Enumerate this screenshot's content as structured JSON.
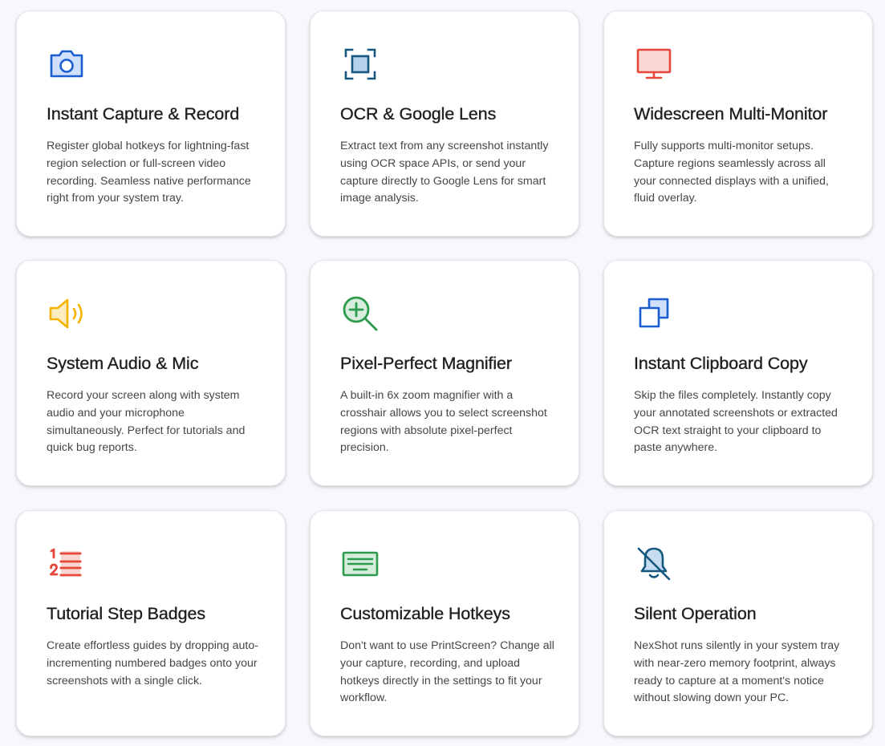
{
  "features": [
    {
      "title": "Instant Capture & Record",
      "description": "Register global hotkeys for lightning-fast region selection or full-screen video recording. Seamless native performance right from your system tray.",
      "icon": "camera-icon",
      "color": "#1a5dd1"
    },
    {
      "title": "OCR & Google Lens",
      "description": "Extract text from any screenshot instantly using OCR space APIs, or send your capture directly to Google Lens for smart image analysis.",
      "icon": "scan-frame-icon",
      "color": "#14577f"
    },
    {
      "title": "Widescreen Multi-Monitor",
      "description": "Fully supports multi-monitor setups. Capture regions seamlessly across all your connected displays with a unified, fluid overlay.",
      "icon": "monitor-icon",
      "color": "#e5483b"
    },
    {
      "title": "System Audio & Mic",
      "description": "Record your screen along with system audio and your microphone simultaneously. Perfect for tutorials and quick bug reports.",
      "icon": "speaker-icon",
      "color": "#f4b400"
    },
    {
      "title": "Pixel-Perfect Magnifier",
      "description": "A built-in 6x zoom magnifier with a crosshair allows you to select screenshot regions with absolute pixel-perfect precision.",
      "icon": "zoom-in-icon",
      "color": "#2e9a4e"
    },
    {
      "title": "Instant Clipboard Copy",
      "description": "Skip the files completely. Instantly copy your annotated screenshots or extracted OCR text straight to your clipboard to paste anywhere.",
      "icon": "copy-icon",
      "color": "#1a5dd1"
    },
    {
      "title": "Tutorial Step Badges",
      "description": "Create effortless guides by dropping auto-incrementing numbered badges onto your screenshots with a single click.",
      "icon": "numbered-list-icon",
      "color": "#e5483b"
    },
    {
      "title": "Customizable Hotkeys",
      "description": "Don't want to use PrintScreen? Change all your capture, recording, and upload hotkeys directly in the settings to fit your workflow.",
      "icon": "keyboard-icon",
      "color": "#2e9a4e"
    },
    {
      "title": "Silent Operation",
      "description": "NexShot runs silently in your system tray with near-zero memory footprint, always ready to capture at a moment's notice without slowing down your PC.",
      "icon": "bell-off-icon",
      "color": "#14577f"
    }
  ]
}
